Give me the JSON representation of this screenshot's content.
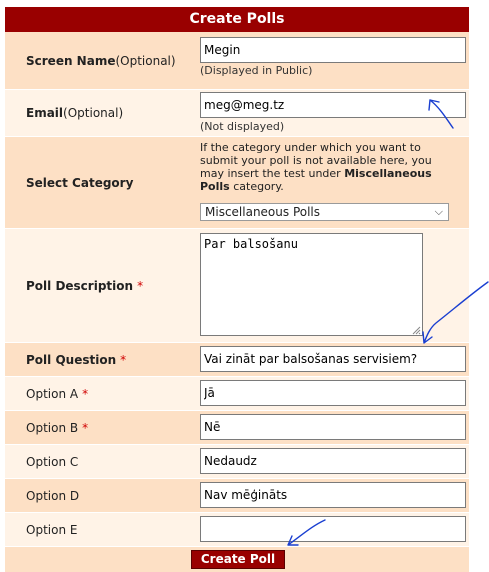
{
  "form": {
    "title": "Create Polls",
    "screen_name": {
      "label": "Screen Name",
      "optional": "(Optional)",
      "value": "Megin",
      "hint": "(Displayed in Public)"
    },
    "email": {
      "label": "Email",
      "optional": "(Optional)",
      "value": "meg@meg.tz",
      "hint": "(Not displayed)"
    },
    "category": {
      "label": "Select Category",
      "info_pre": "If the category under which you want to submit your poll is not available here, you may insert the test under ",
      "info_bold": "Miscellaneous Polls",
      "info_post": " category.",
      "selected": "Miscellaneous Polls"
    },
    "description": {
      "label": "Poll Description",
      "required": "*",
      "value": "Par balsošanu"
    },
    "question": {
      "label": "Poll Question",
      "required": "*",
      "value": "Vai zināt par balsošanas servisiem?"
    },
    "options": [
      {
        "label": "Option A",
        "required": "*",
        "value": "Jā"
      },
      {
        "label": "Option B",
        "required": "*",
        "value": "Nē"
      },
      {
        "label": "Option C",
        "required": "",
        "value": "Nedaudz"
      },
      {
        "label": "Option D",
        "required": "",
        "value": "Nav mēģināts"
      },
      {
        "label": "Option E",
        "required": "",
        "value": ""
      }
    ],
    "submit_label": "Create Poll"
  },
  "colors": {
    "header": "#990000",
    "row": "#fde0c5",
    "row_alt": "#fff3e7",
    "required": "#d00000",
    "annotation": "#1a3fd1"
  },
  "icons": {
    "select_arrow": "chevron-down-icon",
    "resize": "resize-grip-icon"
  }
}
